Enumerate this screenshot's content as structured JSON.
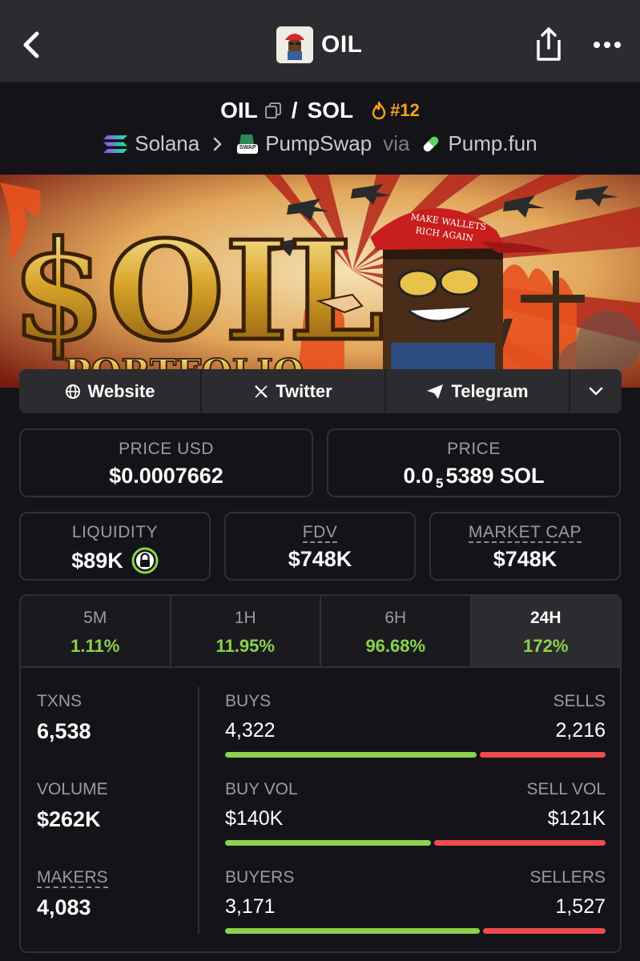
{
  "header": {
    "title": "OIL"
  },
  "pair": {
    "base": "OIL",
    "separator": "/",
    "quote": "SOL",
    "rank": "#12"
  },
  "chain": {
    "network": "Solana",
    "dex": "PumpSwap",
    "dex_badge": "SWAP",
    "via": "via",
    "launchpad": "Pump.fun"
  },
  "banner": {
    "headline": "$OIL",
    "subline": "PORTFOLIO",
    "hat_line1": "MAKE WALLETS",
    "hat_line2": "RICH AGAIN"
  },
  "links": [
    {
      "label": "Website",
      "icon": "globe-icon"
    },
    {
      "label": "Twitter",
      "icon": "x-icon"
    },
    {
      "label": "Telegram",
      "icon": "telegram-icon"
    }
  ],
  "price": {
    "usd_label": "PRICE USD",
    "usd_value": "$0.0007662",
    "native_label": "PRICE",
    "native_prefix": "0.0",
    "native_zeros": "5",
    "native_rest": "5389 SOL"
  },
  "metrics": {
    "liquidity_label": "LIQUIDITY",
    "liquidity_value": "$89K",
    "fdv_label": "FDV",
    "fdv_value": "$748K",
    "mcap_label": "MARKET CAP",
    "mcap_value": "$748K"
  },
  "timeframes": [
    {
      "label": "5M",
      "change": "1.11%"
    },
    {
      "label": "1H",
      "change": "11.95%"
    },
    {
      "label": "6H",
      "change": "96.68%"
    },
    {
      "label": "24H",
      "change": "172%",
      "active": true
    }
  ],
  "stats": {
    "txns_label": "TXNS",
    "txns_value": "6,538",
    "buys_label": "BUYS",
    "buys_value": "4,322",
    "sells_label": "SELLS",
    "sells_value": "2,216",
    "volume_label": "VOLUME",
    "volume_value": "$262K",
    "buyvol_label": "BUY VOL",
    "buyvol_value": "$140K",
    "sellvol_label": "SELL VOL",
    "sellvol_value": "$121K",
    "makers_label": "MAKERS",
    "makers_value": "4,083",
    "buyers_label": "BUYERS",
    "buyers_value": "3,171",
    "sellers_label": "SELLERS",
    "sellers_value": "1,527"
  },
  "colors": {
    "up": "#8bd34a",
    "down": "#ef4b4b",
    "rank": "#f6a21a",
    "surface": "#2c2c30",
    "background": "#141418"
  }
}
